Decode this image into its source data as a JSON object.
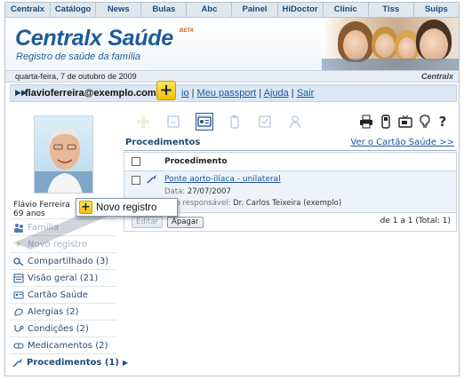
{
  "top_nav": [
    "Centralx",
    "Catálogo",
    "News",
    "Bulas",
    "Abc",
    "Painel",
    "HiDoctor",
    "Clinic",
    "Tiss",
    "Suips"
  ],
  "banner": {
    "brand": "Centralx Saúde",
    "beta": "BETA",
    "tagline": "Registro de saúde da família"
  },
  "date_bar": {
    "date": "quarta-feira, 7 de outubro de 2009",
    "wordmark": "Centralx"
  },
  "user_bar": {
    "email": "flavioferreira@exemplo.com",
    "fragment": "io",
    "links": [
      "Meu passport",
      "Ajuda",
      "Sair"
    ],
    "separator": "|"
  },
  "profile": {
    "name": "Flávio Ferreira",
    "age": "69 anos"
  },
  "sidebar": {
    "items": [
      {
        "label": "Família",
        "icon": "people-icon",
        "state": "faded"
      },
      {
        "label": "Novo registro",
        "icon": "plus-icon",
        "state": "faded"
      },
      {
        "label": "Compartilhado (3)",
        "icon": "key-icon",
        "state": "normal"
      },
      {
        "label": "Visão geral (21)",
        "icon": "calendar-icon",
        "state": "normal"
      },
      {
        "label": "Cartão Saúde",
        "icon": "card-icon",
        "state": "normal"
      },
      {
        "label": "Alergias (2)",
        "icon": "allergy-icon",
        "state": "normal"
      },
      {
        "label": "Condições (2)",
        "icon": "stethoscope-icon",
        "state": "normal"
      },
      {
        "label": "Medicamentos (2)",
        "icon": "pill-icon",
        "state": "normal"
      },
      {
        "label": "Procedimentos (1)",
        "icon": "scalpel-icon",
        "state": "active"
      }
    ]
  },
  "toolbar": {
    "left_icons": [
      "plus-icon",
      "folder-icon",
      "id-card-icon",
      "clipboard-icon",
      "checklist-icon",
      "person-icon"
    ],
    "right_icons": [
      "printer-icon",
      "phone-icon",
      "tv-icon",
      "lightbulb-icon",
      "help-icon"
    ],
    "help_glyph": "?"
  },
  "procedures": {
    "title": "Procedimentos",
    "card_link": "Ver o Cartão Saúde >>",
    "column_header": "Procedimento",
    "rows": [
      {
        "name": "Ponte aorto-ilíaca - unilateral",
        "date_label": "Data:",
        "date": "27/07/2007",
        "doctor_label": "Médico responsável:",
        "doctor_label_visible": "dico responsável:",
        "doctor": "Dr. Carlos Teixeira (exemplo)"
      }
    ],
    "edit_button": "Editar",
    "delete_button": "Apagar",
    "pager": "de 1 a 1 (Total: 1)"
  },
  "callout": {
    "label": "Novo registro",
    "glyph": "+"
  },
  "colors": {
    "brand_blue": "#1e5c98",
    "link_blue": "#1d55a0",
    "highlight_yellow": "#f3c000",
    "row_tint": "#edf3f9"
  }
}
